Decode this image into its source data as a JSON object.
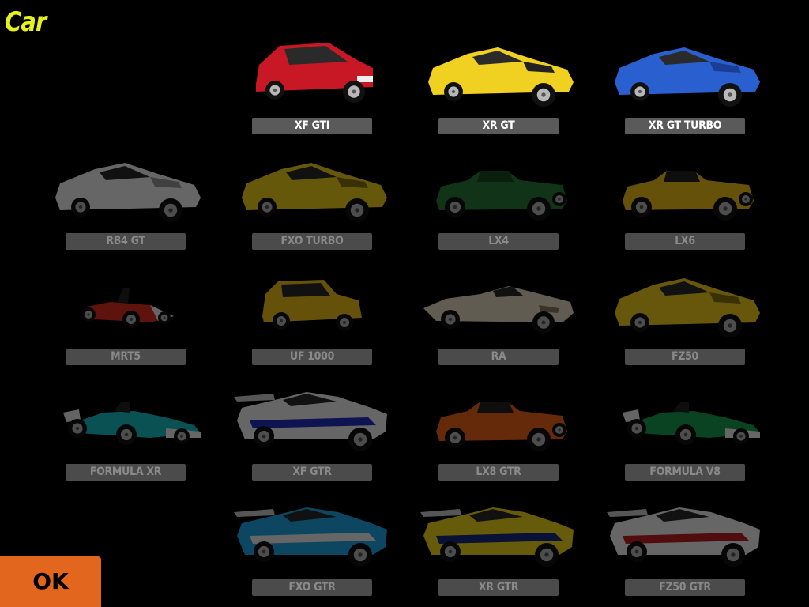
{
  "screen": {
    "title": "Car",
    "ok_label": "OK",
    "accent_color": "#e6f21a",
    "ok_color": "#e2661e"
  },
  "cars": [
    {
      "id": "xf-gti",
      "name": "XF GTI",
      "available": true,
      "kind": "hatch",
      "colors": [
        "#c81826",
        "#8e0f1a"
      ]
    },
    {
      "id": "xr-gt",
      "name": "XR GT",
      "available": true,
      "kind": "coupe",
      "colors": [
        "#f0d020",
        "#222222"
      ]
    },
    {
      "id": "xr-gt-turbo",
      "name": "XR GT TURBO",
      "available": true,
      "kind": "coupe",
      "colors": [
        "#2a5fd0",
        "#1a3e96"
      ]
    },
    {
      "id": "rb4-gt",
      "name": "RB4 GT",
      "available": false,
      "kind": "coupe",
      "colors": [
        "#f2f2f2",
        "#9a9a9a"
      ]
    },
    {
      "id": "fxo-turbo",
      "name": "FXO TURBO",
      "available": false,
      "kind": "coupe",
      "colors": [
        "#f2d21a",
        "#8a7410"
      ]
    },
    {
      "id": "lx4",
      "name": "LX4",
      "available": false,
      "kind": "roadster",
      "colors": [
        "#2a7a3a",
        "#1a4a22"
      ]
    },
    {
      "id": "lx6",
      "name": "LX6",
      "available": false,
      "kind": "roadster",
      "colors": [
        "#f0c01a",
        "#222222"
      ]
    },
    {
      "id": "mrt5",
      "name": "MRT5",
      "available": false,
      "kind": "kart",
      "colors": [
        "#e03020",
        "#f4f4f4"
      ]
    },
    {
      "id": "uf-1000",
      "name": "UF 1000",
      "available": false,
      "kind": "mini",
      "colors": [
        "#f2c21a",
        "#7a6010"
      ]
    },
    {
      "id": "ra",
      "name": "RA",
      "available": false,
      "kind": "spider",
      "colors": [
        "#e8dcc0",
        "#8a7c60"
      ]
    },
    {
      "id": "fz50",
      "name": "FZ50",
      "available": false,
      "kind": "coupe",
      "colors": [
        "#f2d01e",
        "#8a7410"
      ]
    },
    {
      "id": "formula-xr",
      "name": "FORMULA XR",
      "available": false,
      "kind": "formula",
      "colors": [
        "#1ac0c8",
        "#f4f4f4"
      ]
    },
    {
      "id": "xf-gtr",
      "name": "XF GTR",
      "available": false,
      "kind": "race",
      "colors": [
        "#f4f4f4",
        "#2030c0"
      ]
    },
    {
      "id": "lx8-gtr",
      "name": "LX8 GTR",
      "available": false,
      "kind": "roadster",
      "colors": [
        "#f06418",
        "#222222"
      ]
    },
    {
      "id": "formula-v8",
      "name": "FORMULA V8",
      "available": false,
      "kind": "formula",
      "colors": [
        "#1aa050",
        "#f4f4f4"
      ]
    },
    {
      "id": "fxo-gtr",
      "name": "FXO GTR",
      "available": false,
      "kind": "race",
      "colors": [
        "#20a8e8",
        "#f4f4f4"
      ]
    },
    {
      "id": "xr-gtr",
      "name": "XR GTR",
      "available": false,
      "kind": "race",
      "colors": [
        "#f2d81a",
        "#1a2a80"
      ]
    },
    {
      "id": "fz50-gtr",
      "name": "FZ50 GTR",
      "available": false,
      "kind": "race",
      "colors": [
        "#f4f4f4",
        "#c02020"
      ]
    }
  ]
}
